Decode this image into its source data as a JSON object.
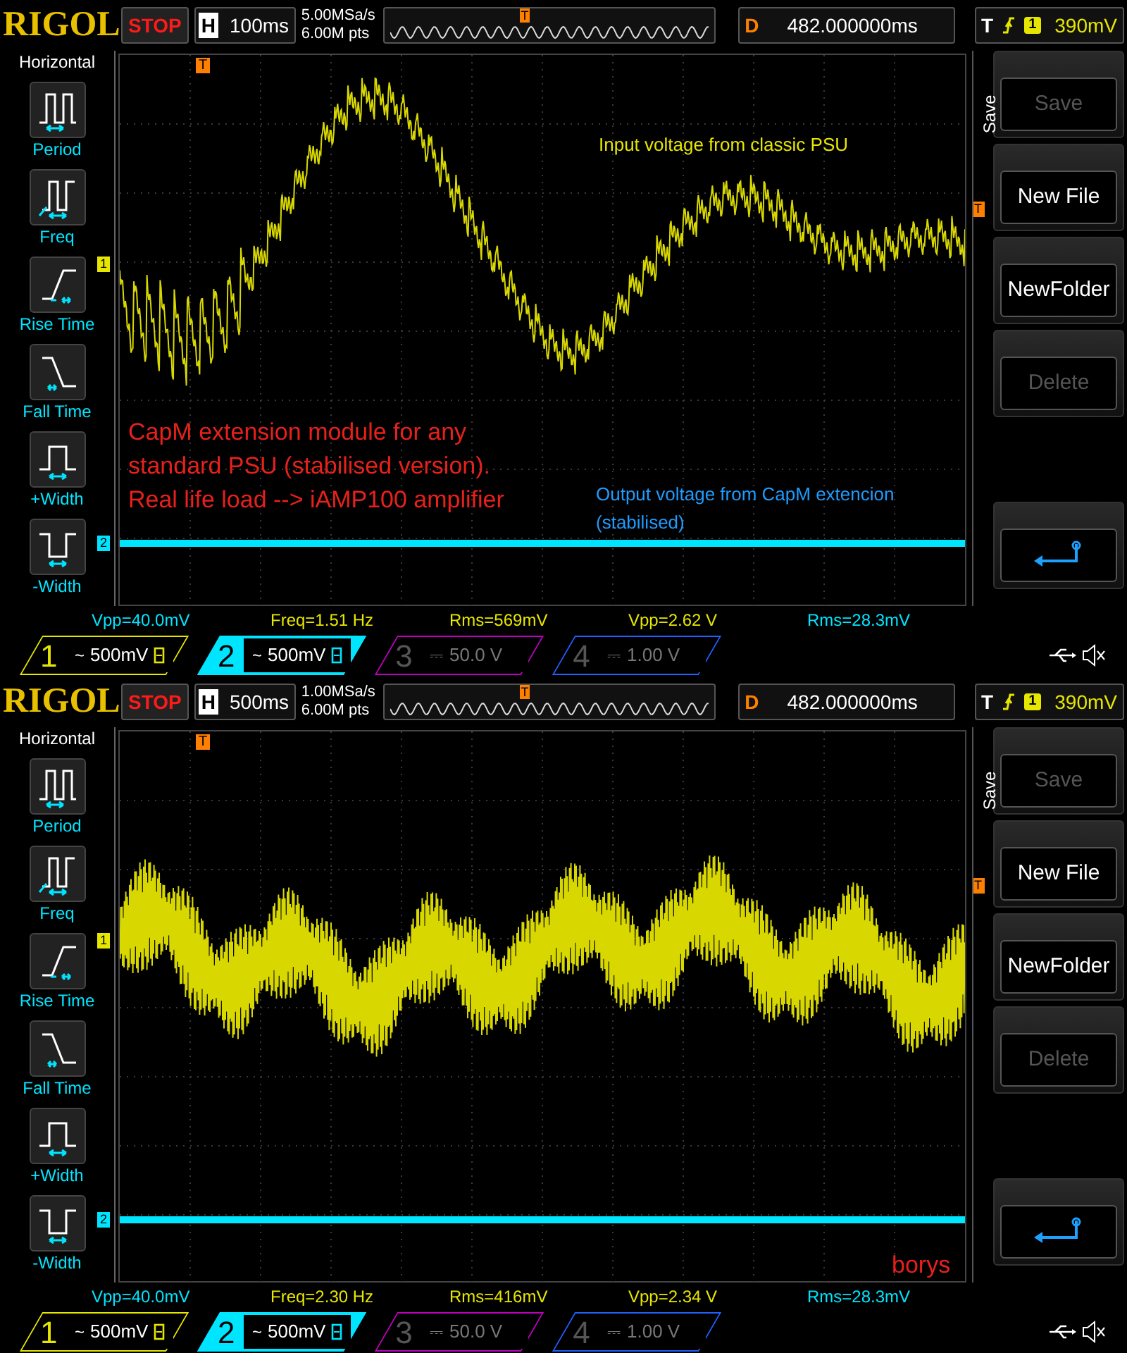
{
  "scopes": [
    {
      "top_bar": {
        "logo": "RIGOL",
        "run_state": "STOP",
        "h_label": "H",
        "overview_trigger_marker": "T",
        "timebase": "100ms",
        "sample_rate": "5.00MSa/s",
        "memory_depth": "6.00M pts",
        "d_label": "D",
        "delay": "482.000000ms",
        "t_label": "T",
        "trigger_source": "1",
        "trigger_level": "390mV"
      },
      "left_menu": {
        "title": "Horizontal",
        "items": [
          {
            "kind": "period",
            "label": "Period"
          },
          {
            "kind": "freq",
            "label": "Freq"
          },
          {
            "kind": "rise",
            "label": "Rise Time"
          },
          {
            "kind": "fall",
            "label": "Fall Time"
          },
          {
            "kind": "pwidth",
            "label": "+Width"
          },
          {
            "kind": "nwidth",
            "label": "-Width"
          }
        ]
      },
      "grid": {
        "trigger_marker": "T",
        "ch1_marker": "1",
        "ch2_marker": "2",
        "level_marker": "T",
        "annotations": [
          {
            "text": "Input voltage from classic PSU",
            "color": "#e6e600"
          },
          {
            "text": "CapM extension module for any\nstandard PSU (stabilised version).\nReal life load --> iAMP100 amplifier",
            "color": "#e8201c"
          },
          {
            "text": "Output voltage from CapM extencion\n(stabilised)",
            "color": "#1e9cff"
          }
        ]
      },
      "right_menu": {
        "title": "Save",
        "buttons": [
          {
            "kind": "text",
            "label": "Save",
            "disabled": true
          },
          {
            "kind": "text",
            "label": "New File",
            "disabled": false
          },
          {
            "kind": "text",
            "label": "NewFolder",
            "disabled": false
          },
          {
            "kind": "text",
            "label": "Delete",
            "disabled": true
          },
          {
            "kind": "back",
            "disabled": false
          }
        ]
      },
      "measurements": [
        {
          "text": "Vpp=40.0mV",
          "color": "#00e5ff"
        },
        {
          "text": "Freq=1.51 Hz",
          "color": "#e6e600"
        },
        {
          "text": "Rms=569mV",
          "color": "#e6e600"
        },
        {
          "text": "Vpp=2.62 V",
          "color": "#e6e600"
        },
        {
          "text": "Rms=28.3mV",
          "color": "#00e5ff"
        }
      ],
      "channels": [
        {
          "number": "1",
          "scale": "500mV",
          "coupling": "~",
          "on": true,
          "selected": false,
          "color": "#e6e600"
        },
        {
          "number": "2",
          "scale": "500mV",
          "coupling": "~",
          "on": true,
          "selected": true,
          "color": "#00e5ff"
        },
        {
          "number": "3",
          "scale": "50.0 V",
          "coupling": "⎓",
          "on": false,
          "selected": false,
          "color": "#c000c0"
        },
        {
          "number": "4",
          "scale": "1.00 V",
          "coupling": "⎓",
          "on": false,
          "selected": false,
          "color": "#2060ff"
        }
      ]
    },
    {
      "top_bar": {
        "logo": "RIGOL",
        "run_state": "STOP",
        "h_label": "H",
        "overview_trigger_marker": "T",
        "timebase": "500ms",
        "sample_rate": "1.00MSa/s",
        "memory_depth": "6.00M pts",
        "d_label": "D",
        "delay": "482.000000ms",
        "t_label": "T",
        "trigger_source": "1",
        "trigger_level": "390mV"
      },
      "left_menu": {
        "title": "Horizontal",
        "items": [
          {
            "kind": "period",
            "label": "Period"
          },
          {
            "kind": "freq",
            "label": "Freq"
          },
          {
            "kind": "rise",
            "label": "Rise Time"
          },
          {
            "kind": "fall",
            "label": "Fall Time"
          },
          {
            "kind": "pwidth",
            "label": "+Width"
          },
          {
            "kind": "nwidth",
            "label": "-Width"
          }
        ]
      },
      "grid": {
        "trigger_marker": "T",
        "ch1_marker": "1",
        "ch2_marker": "2",
        "level_marker": "T",
        "annotations": [
          {
            "text": "borys",
            "color": "#e8201c"
          }
        ]
      },
      "right_menu": {
        "title": "Save",
        "buttons": [
          {
            "kind": "text",
            "label": "Save",
            "disabled": true
          },
          {
            "kind": "text",
            "label": "New File",
            "disabled": false
          },
          {
            "kind": "text",
            "label": "NewFolder",
            "disabled": false
          },
          {
            "kind": "text",
            "label": "Delete",
            "disabled": true
          },
          {
            "kind": "back",
            "disabled": false
          }
        ]
      },
      "measurements": [
        {
          "text": "Vpp=40.0mV",
          "color": "#00e5ff"
        },
        {
          "text": "Freq=2.30 Hz",
          "color": "#e6e600"
        },
        {
          "text": "Rms=416mV",
          "color": "#e6e600"
        },
        {
          "text": "Vpp=2.34 V",
          "color": "#e6e600"
        },
        {
          "text": "Rms=28.3mV",
          "color": "#00e5ff"
        }
      ],
      "channels": [
        {
          "number": "1",
          "scale": "500mV",
          "coupling": "~",
          "on": true,
          "selected": false,
          "color": "#e6e600"
        },
        {
          "number": "2",
          "scale": "500mV",
          "coupling": "~",
          "on": true,
          "selected": true,
          "color": "#00e5ff"
        },
        {
          "number": "3",
          "scale": "50.0 V",
          "coupling": "⎓",
          "on": false,
          "selected": false,
          "color": "#c000c0"
        },
        {
          "number": "4",
          "scale": "1.00 V",
          "coupling": "⎓",
          "on": false,
          "selected": false,
          "color": "#2060ff"
        }
      ]
    }
  ]
}
